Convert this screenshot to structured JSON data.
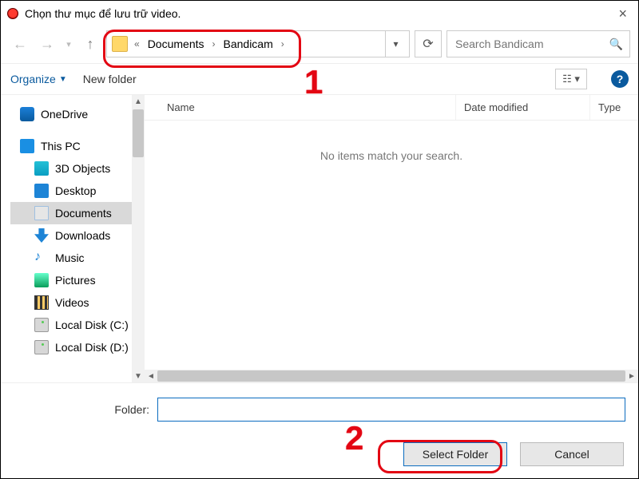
{
  "title": "Chọn thư mục để lưu trữ video.",
  "breadcrumb": {
    "overflow": "«",
    "items": [
      "Documents",
      "Bandicam"
    ]
  },
  "search": {
    "placeholder": "Search Bandicam"
  },
  "toolbar": {
    "organize": "Organize",
    "new_folder": "New folder"
  },
  "tree": {
    "onedrive": "OneDrive",
    "thispc": "This PC",
    "items": [
      "3D Objects",
      "Desktop",
      "Documents",
      "Downloads",
      "Music",
      "Pictures",
      "Videos",
      "Local Disk (C:)",
      "Local Disk (D:)"
    ],
    "selected_index": 2
  },
  "columns": {
    "name": "Name",
    "date": "Date modified",
    "type": "Type"
  },
  "empty_message": "No items match your search.",
  "footer": {
    "folder_label": "Folder:",
    "folder_value": "",
    "select_label": "Select Folder",
    "cancel_label": "Cancel"
  },
  "annotations": {
    "a1": "1",
    "a2": "2"
  }
}
